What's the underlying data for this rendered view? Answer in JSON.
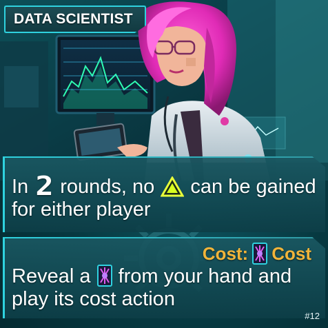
{
  "card": {
    "title": "DATA SCIENTIST",
    "card_number": "#12",
    "accent_color": "#2fd2df",
    "cost_color": "#f0b43a"
  },
  "effect": {
    "text_before": "In",
    "rounds": "2",
    "text_middle": "rounds, no",
    "icon": "triangle-warning-icon",
    "text_after": "can be gained for either player"
  },
  "action": {
    "cost_label": "Cost:",
    "cost_icon": "data-card-icon",
    "cost_word": "Cost",
    "text_before": "Reveal a",
    "icon": "data-card-icon",
    "text_after": "from your hand and play its cost action"
  }
}
